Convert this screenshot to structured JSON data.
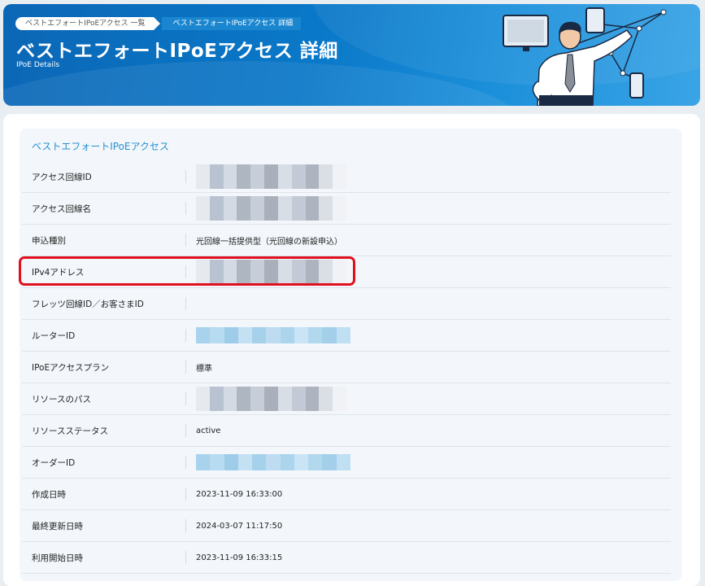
{
  "header": {
    "breadcrumbs": [
      "ベストエフォートIPoEアクセス 一覧",
      "ベストエフォートIPoEアクセス 詳細"
    ],
    "title": "ベストエフォートIPoEアクセス 詳細",
    "subtitle": "IPoE Details"
  },
  "card": {
    "title": "ベストエフォートIPoEアクセス",
    "rows": [
      {
        "label": "アクセス回線ID",
        "value": "",
        "redacted": "gray"
      },
      {
        "label": "アクセス回線名",
        "value": "",
        "redacted": "gray"
      },
      {
        "label": "申込種別",
        "value": "光回線一括提供型（光回線の新設申込）"
      },
      {
        "label": "IPv4アドレス",
        "value": "",
        "redacted": "gray",
        "highlighted": true
      },
      {
        "label": "フレッツ回線ID／お客さまID",
        "value": ""
      },
      {
        "label": "ルーターID",
        "value": "",
        "redacted": "blue"
      },
      {
        "label": "IPoEアクセスプラン",
        "value": "標準"
      },
      {
        "label": "リソースのパス",
        "value": "",
        "redacted": "gray"
      },
      {
        "label": "リソースステータス",
        "value": "active"
      },
      {
        "label": "オーダーID",
        "value": "",
        "redacted": "blue"
      },
      {
        "label": "作成日時",
        "value": "2023-11-09 16:33:00"
      },
      {
        "label": "最終更新日時",
        "value": "2024-03-07 11:17:50"
      },
      {
        "label": "利用開始日時",
        "value": "2023-11-09 16:33:15"
      }
    ]
  },
  "colors": {
    "header_blue": "#0a78c8",
    "accent": "#2690cf",
    "highlight_red": "#e0101e"
  }
}
